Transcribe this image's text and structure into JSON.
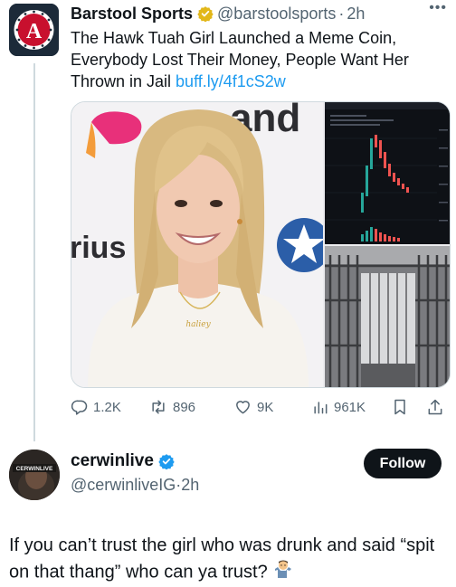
{
  "quoted_tweet": {
    "display_name": "Barstool Sports",
    "handle": "@barstoolsports",
    "separator": "·",
    "time": "2h",
    "more_icon": "•••",
    "text_before_link": "The Hawk Tuah Girl Launched a Meme Coin, Everybody Lost Their Money, People Want Her Thrown in Jail ",
    "link": "buff.ly/4f1cS2w",
    "media": {
      "backdrop_text_1": "and",
      "backdrop_text_2": "rius",
      "necklace_text": "haliey"
    },
    "actions": {
      "replies": "1.2K",
      "reposts": "896",
      "likes": "9K",
      "views": "961K"
    }
  },
  "reply": {
    "display_name": "cerwinlive",
    "handle": "@cerwinliveIG",
    "separator": "·",
    "time": "2h",
    "avatar_label": "CERWINLIVE",
    "follow_label": "Follow",
    "text": "If you can’t trust the girl who was drunk and said “spit on that thang” who can ya trust?",
    "emoji": "man-shrugging-emoji"
  },
  "colors": {
    "verified_gold": "#e2b719",
    "verified_blue": "#1d9bf0",
    "link": "#1d9bf0",
    "muted": "#536471"
  }
}
